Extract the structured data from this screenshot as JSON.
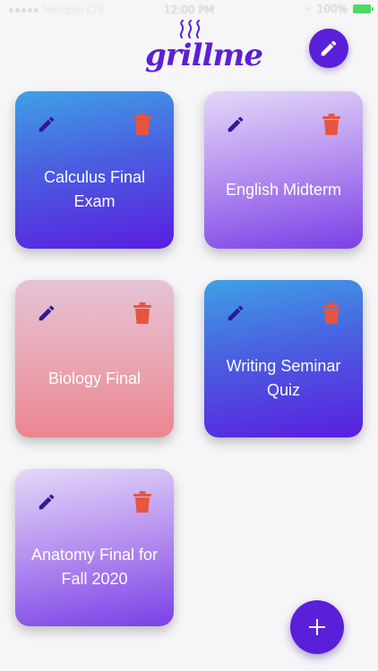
{
  "status_bar": {
    "carrier": "Verizon LTE",
    "time": "12:00 PM",
    "battery": "100%"
  },
  "app": {
    "logo_text": "grillme",
    "brand_color": "#5a1fd8"
  },
  "header": {
    "edit_icon": "pencil-icon"
  },
  "cards": [
    {
      "title": "Calculus Final Exam",
      "edit_icon": "pencil-icon",
      "delete_icon": "trash-icon",
      "style": "blue"
    },
    {
      "title": "English Midterm",
      "edit_icon": "pencil-icon",
      "delete_icon": "trash-icon",
      "style": "lavender"
    },
    {
      "title": "Biology Final",
      "edit_icon": "pencil-icon",
      "delete_icon": "trash-icon",
      "style": "pink"
    },
    {
      "title": "Writing Seminar Quiz",
      "edit_icon": "pencil-icon",
      "delete_icon": "trash-icon",
      "style": "blue"
    },
    {
      "title": "Anatomy Final for Fall 2020",
      "edit_icon": "pencil-icon",
      "delete_icon": "trash-icon",
      "style": "lavender"
    }
  ],
  "colors": {
    "pencil": "#3a1aa8",
    "trash": "#e8553e",
    "fab": "#5a1fd8"
  },
  "fab": {
    "icon": "plus-icon"
  }
}
